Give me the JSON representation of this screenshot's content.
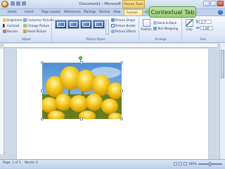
{
  "window": {
    "title": "Document1 - Microsoft Word",
    "contextual_group": "Picture Tools"
  },
  "tabs": [
    "Home",
    "Insert",
    "Page Layout",
    "References",
    "Mailings",
    "Review",
    "View",
    "Format"
  ],
  "ribbon": {
    "adjust": {
      "label": "Adjust",
      "commands": [
        "Brightness",
        "Contrast",
        "Recolor",
        "Compress Pictures",
        "Change Picture",
        "Reset Picture"
      ]
    },
    "picture_styles": {
      "label": "Picture Styles",
      "commands": [
        "Picture Shape",
        "Picture Border",
        "Picture Effects"
      ]
    },
    "arrange": {
      "label": "Arrange",
      "position_label": "Position",
      "commands": [
        "Send to Back",
        "Text Wrapping"
      ]
    },
    "size": {
      "label": "Size",
      "crop_label": "Crop",
      "height": "2.7\"",
      "width": "3.98\""
    }
  },
  "callout": {
    "text": "Contextual Tab"
  },
  "status": {
    "page": "Page: 1 of 1",
    "words": "Words: 0",
    "zoom": "100%"
  },
  "colors": {
    "ribbon_bg": "#dfe8f5",
    "callout_bg": "#a9d98c",
    "contextual_tab": "#f8e7a7"
  }
}
